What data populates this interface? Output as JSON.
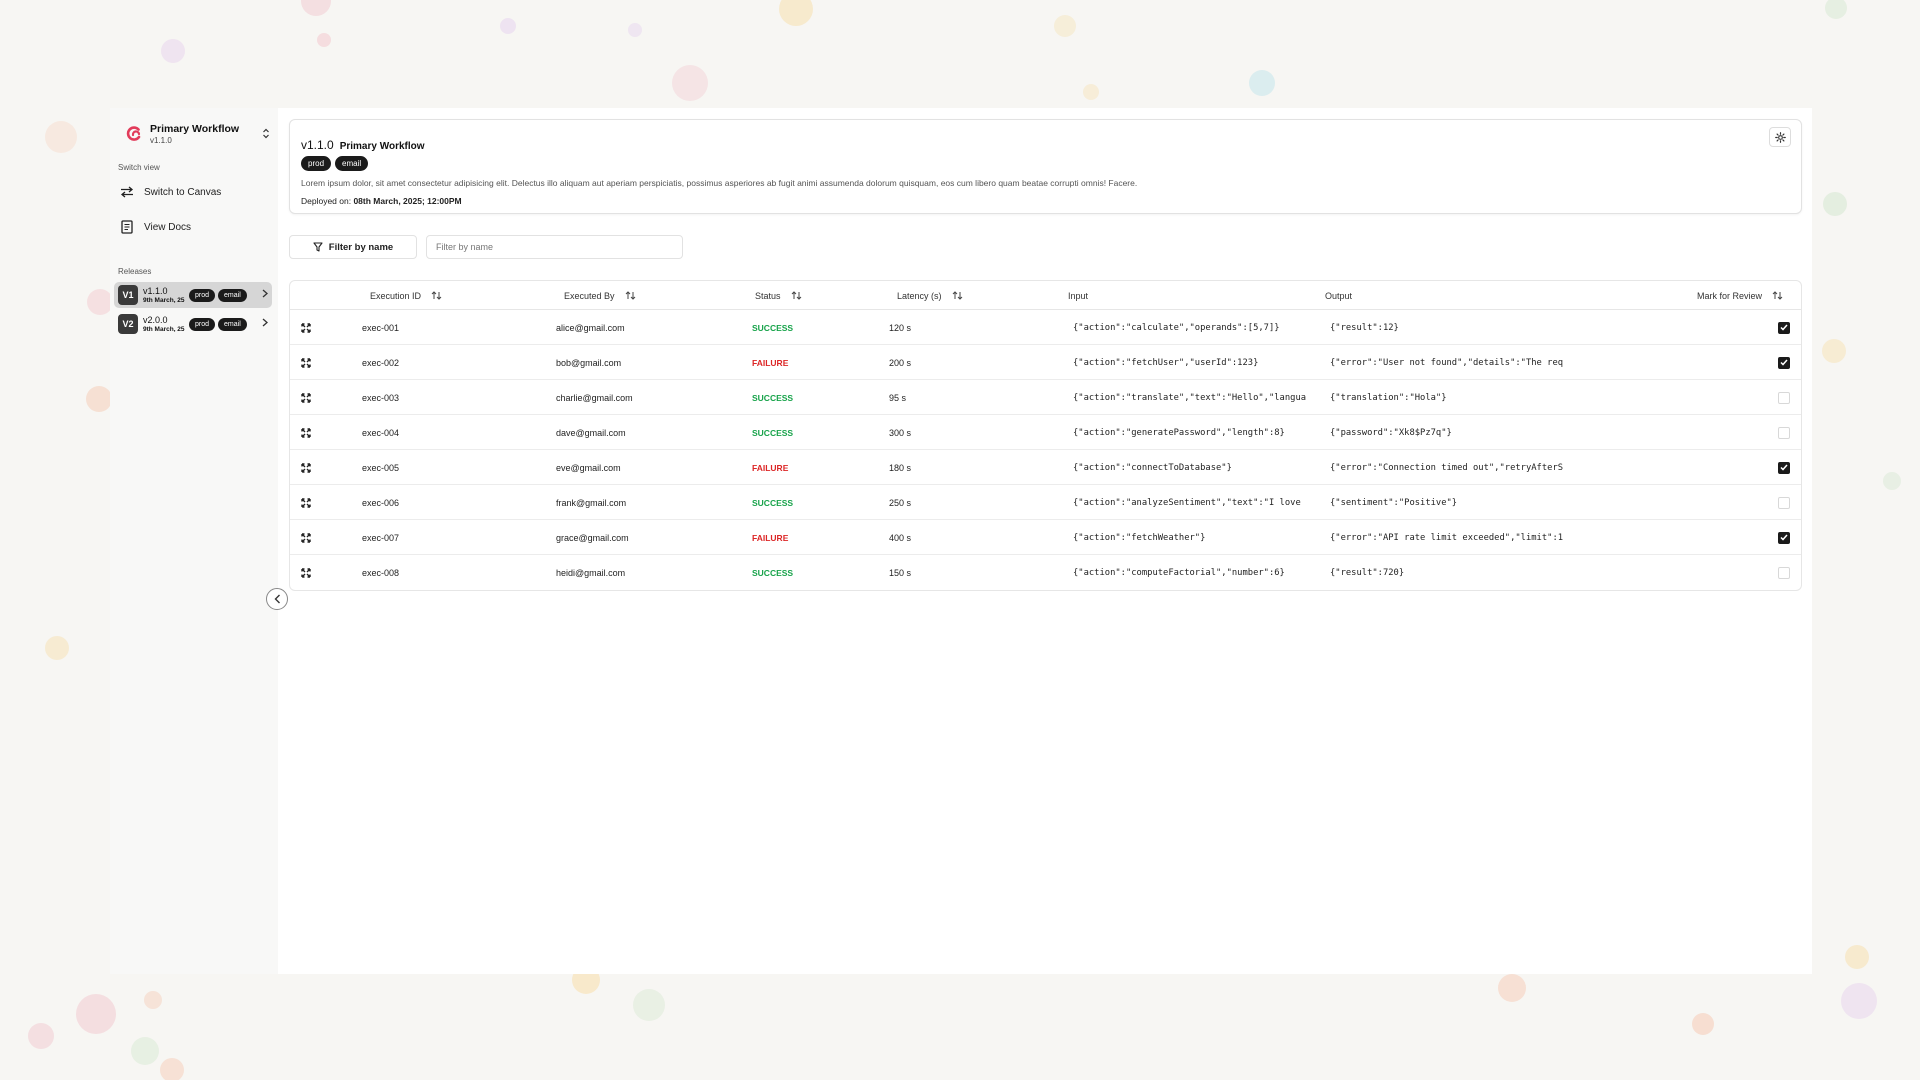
{
  "sidebar": {
    "workspace": {
      "name": "Primary Workflow",
      "version": "v1.1.0",
      "logo": "workflow-logo-icon",
      "switcher_icon": "chevron-updown-icon"
    },
    "switch_view_label": "Switch view",
    "nav": [
      {
        "label": "Switch to Canvas",
        "icon": "arrows-swap-icon"
      },
      {
        "label": "View Docs",
        "icon": "document-icon"
      }
    ],
    "releases_label": "Releases",
    "releases": [
      {
        "avatar": "V1",
        "version": "v1.1.0",
        "date": "9th March, 25",
        "tags": [
          "prod",
          "email"
        ],
        "active": true
      },
      {
        "avatar": "V2",
        "version": "v2.0.0",
        "date": "9th March, 25",
        "tags": [
          "prod",
          "email"
        ],
        "active": false
      }
    ]
  },
  "header": {
    "version": "v1.1.0",
    "name": "Primary Workflow",
    "tags": [
      "prod",
      "email"
    ],
    "description": "Lorem ipsum dolor, sit amet consectetur adipisicing elit. Delectus illo aliquam aut aperiam perspiciatis, possimus asperiores ab fugit animi assumenda dolorum quisquam, eos cum libero quam beatae corrupti omnis! Facere.",
    "deployed_label": "Deployed on: ",
    "deployed_value": "08th March, 2025; 12:00PM",
    "settings_icon": "gear-icon"
  },
  "filter": {
    "button_label": "Filter by name",
    "input_placeholder": "Filter by name",
    "input_value": ""
  },
  "table": {
    "columns": [
      "Execution ID",
      "Executed By",
      "Status",
      "Latency (s)",
      "Input",
      "Output",
      "Mark for Review"
    ],
    "rows": [
      {
        "id": "exec-001",
        "by": "alice@gmail.com",
        "status": "SUCCESS",
        "latency": "120 s",
        "input": "{\"action\":\"calculate\",\"operands\":[5,7]}",
        "output": "{\"result\":12}",
        "review": true
      },
      {
        "id": "exec-002",
        "by": "bob@gmail.com",
        "status": "FAILURE",
        "latency": "200 s",
        "input": "{\"action\":\"fetchUser\",\"userId\":123}",
        "output": "{\"error\":\"User not found\",\"details\":\"The req",
        "review": true
      },
      {
        "id": "exec-003",
        "by": "charlie@gmail.com",
        "status": "SUCCESS",
        "latency": "95 s",
        "input": "{\"action\":\"translate\",\"text\":\"Hello\",\"langua",
        "output": "{\"translation\":\"Hola\"}",
        "review": false
      },
      {
        "id": "exec-004",
        "by": "dave@gmail.com",
        "status": "SUCCESS",
        "latency": "300 s",
        "input": "{\"action\":\"generatePassword\",\"length\":8}",
        "output": "{\"password\":\"Xk8$Pz7q\"}",
        "review": false
      },
      {
        "id": "exec-005",
        "by": "eve@gmail.com",
        "status": "FAILURE",
        "latency": "180 s",
        "input": "{\"action\":\"connectToDatabase\"}",
        "output": "{\"error\":\"Connection timed out\",\"retryAfterS",
        "review": true
      },
      {
        "id": "exec-006",
        "by": "frank@gmail.com",
        "status": "SUCCESS",
        "latency": "250 s",
        "input": "{\"action\":\"analyzeSentiment\",\"text\":\"I love",
        "output": "{\"sentiment\":\"Positive\"}",
        "review": false
      },
      {
        "id": "exec-007",
        "by": "grace@gmail.com",
        "status": "FAILURE",
        "latency": "400 s",
        "input": "{\"action\":\"fetchWeather\"}",
        "output": "{\"error\":\"API rate limit exceeded\",\"limit\":1",
        "review": true
      },
      {
        "id": "exec-008",
        "by": "heidi@gmail.com",
        "status": "SUCCESS",
        "latency": "150 s",
        "input": "{\"action\":\"computeFactorial\",\"number\":6}",
        "output": "{\"result\":720}",
        "review": false
      }
    ]
  },
  "colors": {
    "success": "#17a34a",
    "failure": "#dc2626",
    "brand": "#e23b5a",
    "tag_bg": "#1b1b1b"
  }
}
